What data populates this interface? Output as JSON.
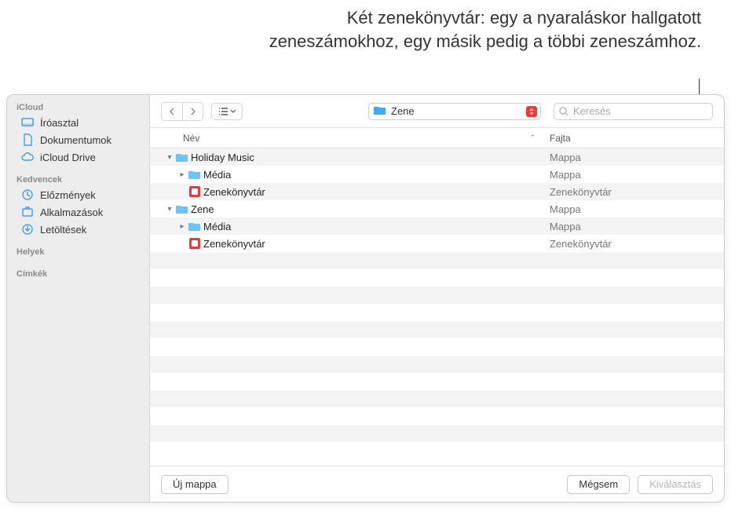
{
  "caption": "Két zenekönyvtár: egy a nyaraláskor hallgatott zeneszámokhoz, egy másik pedig a többi zeneszámhoz.",
  "sidebar": {
    "sections": [
      {
        "title": "iCloud",
        "items": [
          {
            "icon": "desktop",
            "label": "Íróasztal"
          },
          {
            "icon": "doc",
            "label": "Dokumentumok"
          },
          {
            "icon": "cloud",
            "label": "iCloud Drive"
          }
        ]
      },
      {
        "title": "Kedvencek",
        "items": [
          {
            "icon": "clock",
            "label": "Előzmények"
          },
          {
            "icon": "apps",
            "label": "Alkalmazások"
          },
          {
            "icon": "download",
            "label": "Letöltések"
          }
        ]
      },
      {
        "title": "Helyek",
        "items": []
      },
      {
        "title": "Címkék",
        "items": []
      }
    ]
  },
  "toolbar": {
    "path_label": "Zene",
    "search_placeholder": "Keresés"
  },
  "columns": {
    "name": "Név",
    "kind": "Fajta"
  },
  "rows": [
    {
      "level": 0,
      "disclosure": "down",
      "icon": "folder",
      "name": "Holiday Music",
      "kind": "Mappa"
    },
    {
      "level": 1,
      "disclosure": "right",
      "icon": "folder",
      "name": "Média",
      "kind": "Mappa"
    },
    {
      "level": 1,
      "disclosure": "",
      "icon": "libfile",
      "name": "Zenekönyvtár",
      "kind": "Zenekönyvtár"
    },
    {
      "level": 0,
      "disclosure": "down",
      "icon": "folder",
      "name": "Zene",
      "kind": "Mappa"
    },
    {
      "level": 1,
      "disclosure": "right",
      "icon": "folder",
      "name": "Média",
      "kind": "Mappa"
    },
    {
      "level": 1,
      "disclosure": "",
      "icon": "libfile",
      "name": "Zenekönyvtár",
      "kind": "Zenekönyvtár"
    }
  ],
  "footer": {
    "new_folder": "Új mappa",
    "cancel": "Mégsem",
    "choose": "Kiválasztás"
  }
}
